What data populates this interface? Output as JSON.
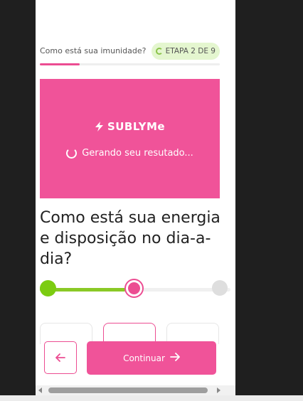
{
  "header": {
    "question_label": "Como está sua imunidade?",
    "step_badge": "ETAPA 2 DE 9",
    "progress": 0.22
  },
  "loading_card": {
    "brand": "SUBLYMe",
    "message": "Gerando seu resutado...",
    "background": "#f05399"
  },
  "question": {
    "text": "Como está sua energia e disposição no dia-a-dia?"
  },
  "slider": {
    "value": 0.5,
    "fill_color": "#8ac926",
    "thumb_color": "#ec4d92"
  },
  "options": [
    {
      "selected": false
    },
    {
      "selected": true
    },
    {
      "selected": false
    }
  ],
  "footer": {
    "back_icon": "arrow-left-icon",
    "continue_label": "Continuar",
    "continue_icon": "arrow-right-icon"
  },
  "colors": {
    "accent": "#ec4d92",
    "success": "#8ac926",
    "badge_bg": "#e4f6cf"
  }
}
